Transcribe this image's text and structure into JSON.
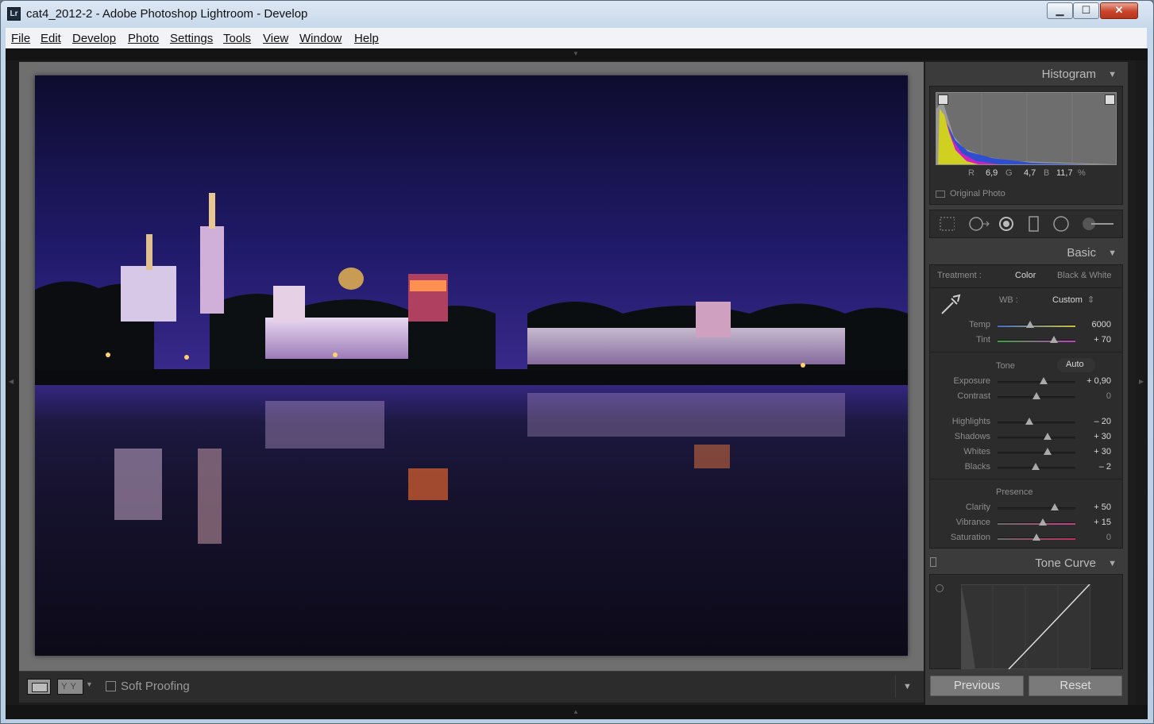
{
  "window": {
    "title": "cat4_2012-2 - Adobe Photoshop Lightroom - Develop",
    "app_icon": "Lr",
    "minimize": "▁",
    "maximize": "☐",
    "close": "✕"
  },
  "menu": [
    "File",
    "Edit",
    "Develop",
    "Photo",
    "Settings",
    "Tools",
    "View",
    "Window",
    "Help"
  ],
  "toolbar": {
    "compare_glyph": "YY",
    "soft_proofing_label": "Soft Proofing",
    "soft_proofing_checked": false
  },
  "histogram": {
    "title": "Histogram",
    "r_label": "R",
    "r_value": "6,9",
    "g_label": "G",
    "g_value": "4,7",
    "b_label": "B",
    "b_value": "11,7",
    "unit": "%",
    "original_photo_label": "Original Photo"
  },
  "basic": {
    "title": "Basic",
    "treatment_label": "Treatment :",
    "treatment_color": "Color",
    "treatment_bw": "Black & White",
    "wb_label": "WB :",
    "wb_value": "Custom",
    "tone_label": "Tone",
    "auto_label": "Auto",
    "presence_label": "Presence",
    "sliders": [
      {
        "label": "Temp",
        "value": "6000",
        "pos": 0.42
      },
      {
        "label": "Tint",
        "value": "+ 70",
        "pos": 0.72
      },
      {
        "label": "Exposure",
        "value": "+ 0,90",
        "pos": 0.59
      },
      {
        "label": "Contrast",
        "value": "0",
        "pos": 0.5
      },
      {
        "label": "Highlights",
        "value": "– 20",
        "pos": 0.41
      },
      {
        "label": "Shadows",
        "value": "+ 30",
        "pos": 0.64
      },
      {
        "label": "Whites",
        "value": "+ 30",
        "pos": 0.64
      },
      {
        "label": "Blacks",
        "value": "– 2",
        "pos": 0.49
      },
      {
        "label": "Clarity",
        "value": "+ 50",
        "pos": 0.73
      },
      {
        "label": "Vibrance",
        "value": "+ 15",
        "pos": 0.58
      },
      {
        "label": "Saturation",
        "value": "0",
        "pos": 0.5
      }
    ]
  },
  "tone_curve": {
    "title": "Tone Curve"
  },
  "buttons": {
    "previous": "Previous",
    "reset": "Reset"
  },
  "colors": {
    "accent_blue": "#2a3a8f",
    "panel_bg": "#3b3b3b",
    "photo_sky": "#2a2a8a"
  }
}
